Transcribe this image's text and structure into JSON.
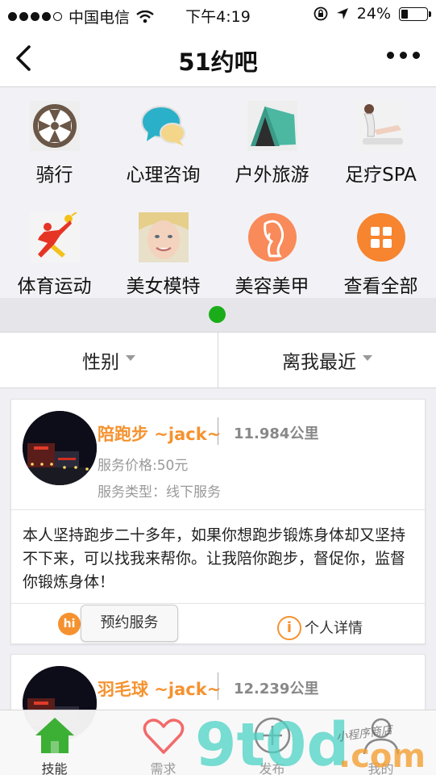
{
  "status_bar": {
    "carrier": "中国电信",
    "time": "下午4:19",
    "battery": "24%",
    "battery_level": 0.24
  },
  "nav": {
    "title": "51约吧"
  },
  "categories": [
    {
      "label": "骑行",
      "icon": "bicycle-wheel-icon"
    },
    {
      "label": "心理咨询",
      "icon": "chat-bubbles-icon"
    },
    {
      "label": "户外旅游",
      "icon": "tent-icon"
    },
    {
      "label": "足疗SPA",
      "icon": "foot-spa-icon"
    },
    {
      "label": "体育运动",
      "icon": "athlete-icon"
    },
    {
      "label": "美女模特",
      "icon": "model-face-icon"
    },
    {
      "label": "美容美甲",
      "icon": "beauty-lady-icon"
    },
    {
      "label": "查看全部",
      "icon": "grid-all-icon"
    }
  ],
  "filters": {
    "gender": "性别",
    "distance": "离我最近"
  },
  "cards": [
    {
      "name": "陪跑步 ~jack~",
      "distance": "11.984公里",
      "price": "服务价格:50元",
      "service_type": "服务类型：线下服务",
      "description": "本人坚持跑步二十多年，如果你想跑步锻炼身体却又坚持不下来，可以找我来帮你。让我陪你跑步，督促你，监督你锻炼身体！",
      "hi": "hi",
      "book_label": "预约服务",
      "info_glyph": "i",
      "detail_label": "个人详情"
    },
    {
      "name": "羽毛球 ~jack~",
      "distance": "12.239公里"
    }
  ],
  "tabs": [
    {
      "label": "技能",
      "icon": "home-icon"
    },
    {
      "label": "需求",
      "icon": "heart-icon"
    },
    {
      "label": "发布",
      "icon": "plus-circle-icon"
    },
    {
      "label": "我的",
      "icon": "user-icon"
    }
  ],
  "watermark": {
    "text": "9t0d.com",
    "sub": "小程序商店"
  },
  "colors": {
    "accent": "#f5922f",
    "green": "#1aad19"
  }
}
